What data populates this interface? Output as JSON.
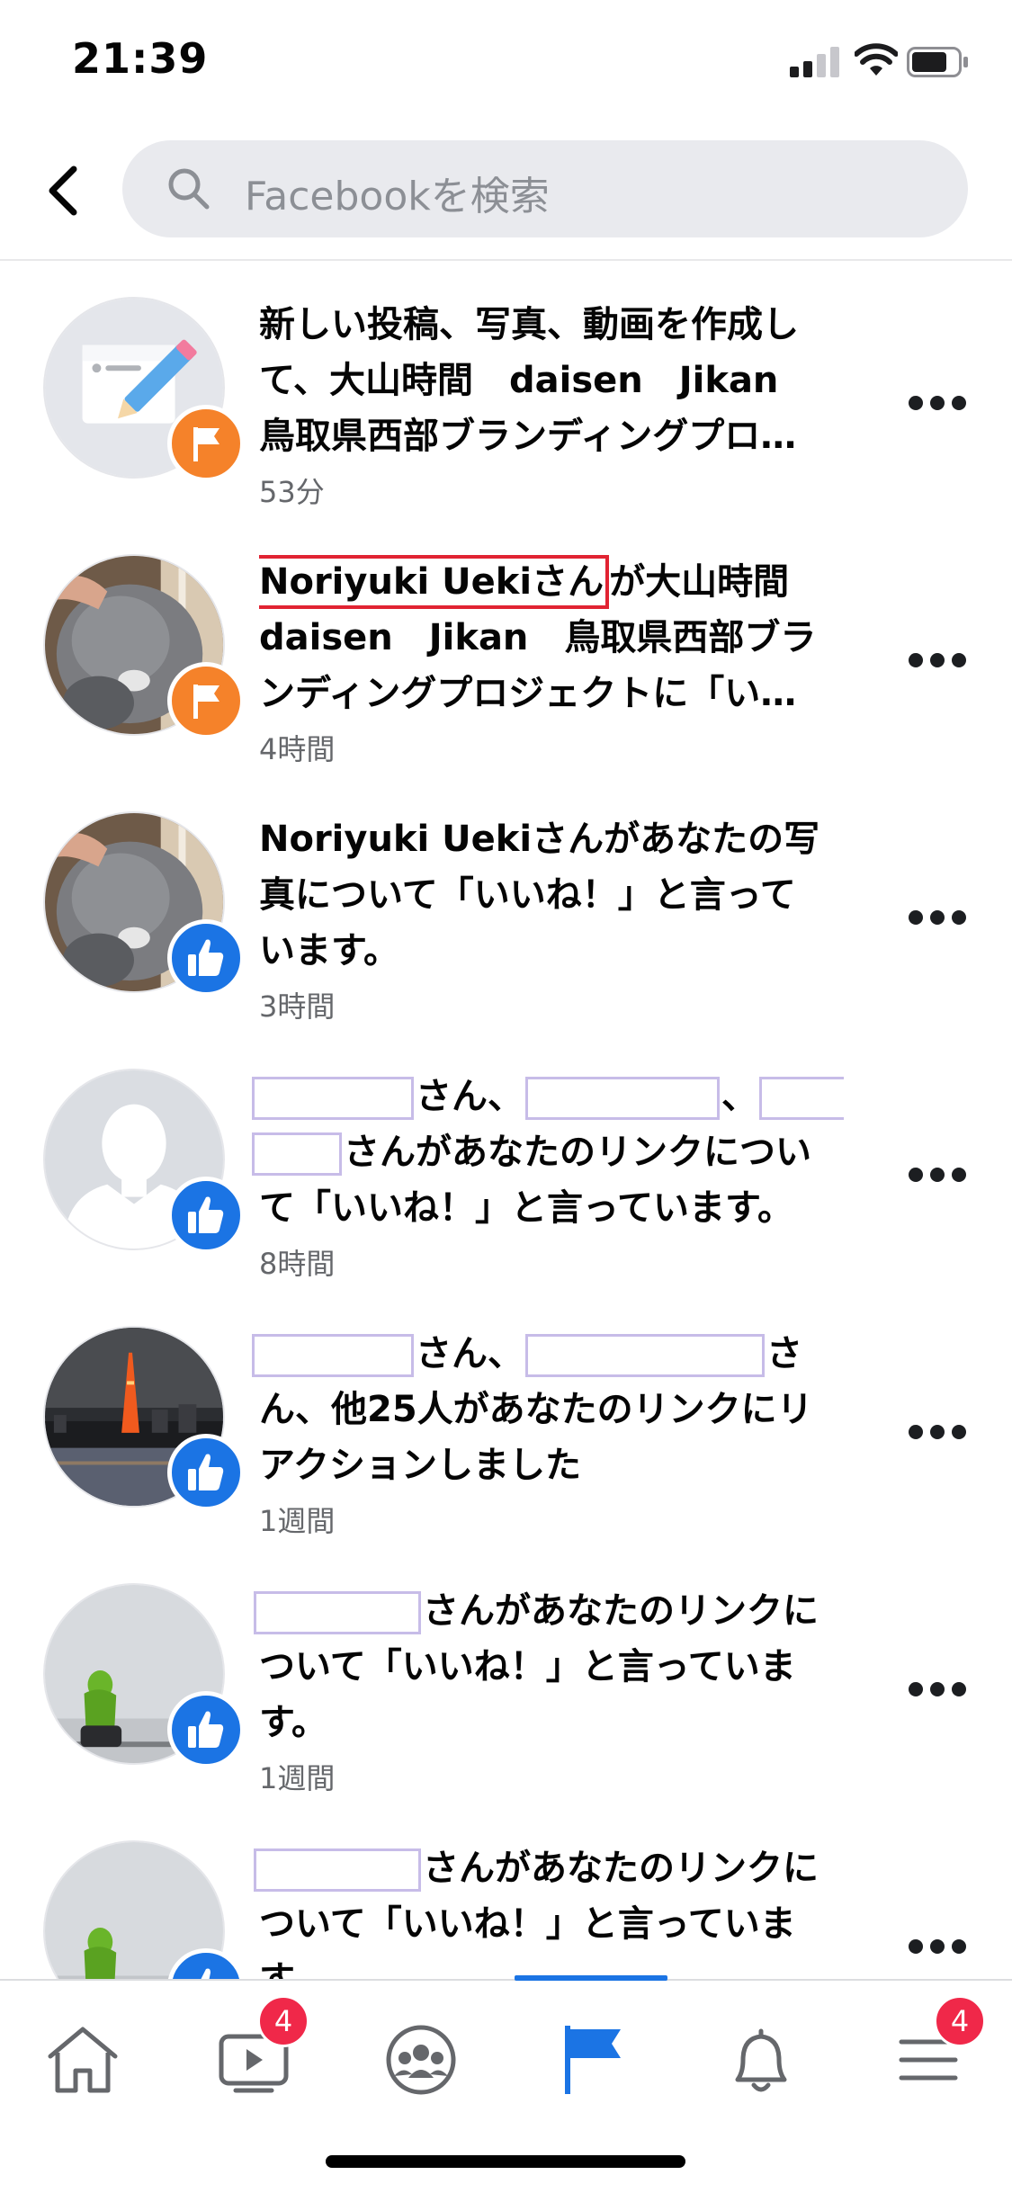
{
  "status_bar": {
    "time": "21:39"
  },
  "search": {
    "placeholder": "Facebookを検索"
  },
  "notifications": [
    {
      "lines": [
        "新しい投稿、写真、動画を作成し",
        "て、大山時間　daisen　Jikan",
        "鳥取県西部ブランディングプロ…"
      ],
      "time": "53分",
      "badge": "flag-icon",
      "avatar": "compose-icon"
    },
    {
      "name": "Noriyuki Uekiさん",
      "line1_rest": "が大山時間",
      "lines": [
        "daisen　Jikan　鳥取県西部ブラ",
        "ンディングプロジェクトに「い…"
      ],
      "time": "4時間",
      "badge": "flag-icon",
      "avatar": "cat-photo"
    },
    {
      "lines": [
        "Noriyuki Uekiさんがあなたの写",
        "真について「いいね！」と言って",
        "います。"
      ],
      "time": "3時間",
      "badge": "like-icon",
      "avatar": "cat-photo"
    },
    {
      "line1": [
        "さん、",
        "、"
      ],
      "line2": "さんがあなたのリンクについ",
      "line3": "て「いいね！」と言っています。",
      "time": "8時間",
      "badge": "like-icon",
      "avatar": "default-profile-icon"
    },
    {
      "line1": [
        "さん、",
        "さ"
      ],
      "line2": "ん、他25人があなたのリンクにリ",
      "line3": "アクションしました",
      "time": "1週間",
      "badge": "like-icon",
      "avatar": "tokyo-tower-photo"
    },
    {
      "line1": "さんがあなたのリンクに",
      "line2": "ついて「いいね！」と言っていま",
      "line3": "す。",
      "time": "1週間",
      "badge": "like-icon",
      "avatar": "person-fog-photo"
    },
    {
      "line1": "さんがあなたのリンクに",
      "line2": "ついて「いいね！」と言っていま",
      "line3": "す。",
      "badge": "like-icon",
      "avatar": "person-fog-photo"
    }
  ],
  "tabbar": {
    "tabs": [
      "home-icon",
      "watch-icon",
      "groups-icon",
      "pages-flag-icon",
      "notifications-bell-icon",
      "menu-icon"
    ],
    "active": "pages-flag-icon",
    "watch_badge": "4",
    "menu_badge": "4"
  },
  "colors": {
    "accent": "#1b74e4",
    "badge_red": "#f02849",
    "flag_orange": "#f5822a",
    "highlight_box": "#e12332"
  }
}
